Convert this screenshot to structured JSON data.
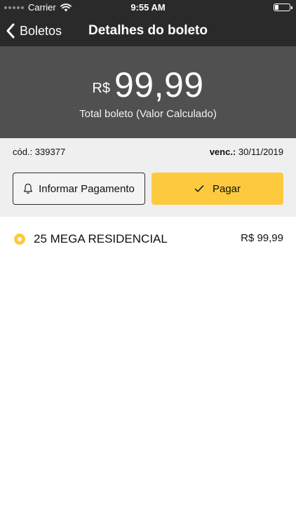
{
  "status_bar": {
    "carrier": "Carrier",
    "time": "9:55 AM"
  },
  "nav": {
    "back_label": "Boletos",
    "title": "Detalhes do boleto"
  },
  "summary": {
    "currency": "R$",
    "amount": "99,99",
    "caption": "Total boleto (Valor Calculado)"
  },
  "details": {
    "code_text": "cód.: 339377",
    "due_label": "venc.:",
    "due_date": "30/11/2019"
  },
  "actions": {
    "inform_label": "Informar Pagamento",
    "pay_label": "Pagar"
  },
  "items": [
    {
      "name": "25 MEGA RESIDENCIAL",
      "price": "R$ 99,99",
      "status_color": "#fdca3f"
    }
  ],
  "colors": {
    "accent": "#fdca3f",
    "header_bg": "#2a2a2a",
    "hero_bg": "#505050",
    "panel_bg": "#efefef"
  }
}
